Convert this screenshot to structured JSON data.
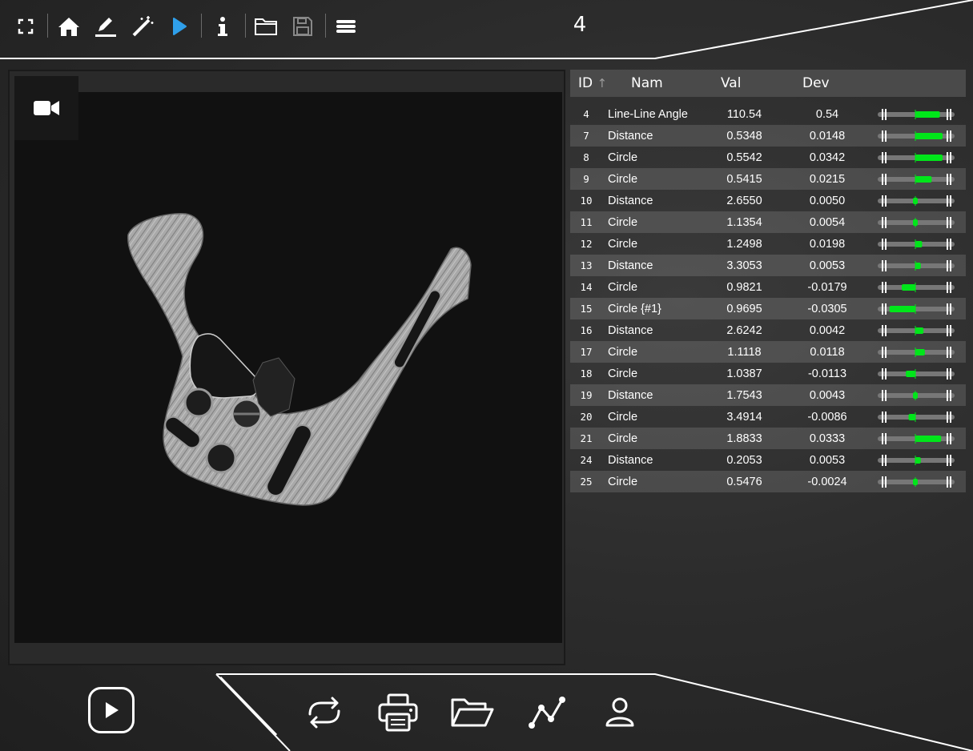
{
  "header": {
    "counter": "4"
  },
  "toolbar": {
    "icons": [
      "fullscreen-icon",
      "home-icon",
      "edit-icon",
      "magic-wand-icon",
      "play-icon",
      "info-icon",
      "folder-icon",
      "save-icon",
      "menu-icon"
    ],
    "active_icon": "play-icon"
  },
  "viewer": {
    "camera_icon": "video-camera-icon"
  },
  "table": {
    "headers": {
      "id": "ID",
      "sort_arrow": "↑",
      "name": "Nam",
      "value": "Val",
      "deviation": "Dev"
    },
    "rows": [
      {
        "id": "4",
        "name": "Line-Line Angle",
        "value": "110.54",
        "dev": "0.54",
        "bar": 0.9
      },
      {
        "id": "7",
        "name": "Distance",
        "value": "0.5348",
        "dev": "0.0148",
        "bar": 1.0
      },
      {
        "id": "8",
        "name": "Circle",
        "value": "0.5542",
        "dev": "0.0342",
        "bar": 1.0
      },
      {
        "id": "9",
        "name": "Circle",
        "value": "0.5415",
        "dev": "0.0215",
        "bar": 0.6
      },
      {
        "id": "10",
        "name": "Distance",
        "value": "2.6550",
        "dev": "0.0050",
        "bar": 0.08
      },
      {
        "id": "11",
        "name": "Circle",
        "value": "1.1354",
        "dev": "0.0054",
        "bar": 0.08
      },
      {
        "id": "12",
        "name": "Circle",
        "value": "1.2498",
        "dev": "0.0198",
        "bar": 0.25
      },
      {
        "id": "13",
        "name": "Distance",
        "value": "3.3053",
        "dev": "0.0053",
        "bar": 0.2
      },
      {
        "id": "14",
        "name": "Circle",
        "value": "0.9821",
        "dev": "-0.0179",
        "bar": -0.5
      },
      {
        "id": "15",
        "name": "Circle {#1}",
        "value": "0.9695",
        "dev": "-0.0305",
        "bar": -0.95
      },
      {
        "id": "16",
        "name": "Distance",
        "value": "2.6242",
        "dev": "0.0042",
        "bar": 0.3
      },
      {
        "id": "17",
        "name": "Circle",
        "value": "1.1118",
        "dev": "0.0118",
        "bar": 0.35
      },
      {
        "id": "18",
        "name": "Circle",
        "value": "1.0387",
        "dev": "-0.0113",
        "bar": -0.35
      },
      {
        "id": "19",
        "name": "Distance",
        "value": "1.7543",
        "dev": "0.0043",
        "bar": 0.08
      },
      {
        "id": "20",
        "name": "Circle",
        "value": "3.4914",
        "dev": "-0.0086",
        "bar": -0.25
      },
      {
        "id": "21",
        "name": "Circle",
        "value": "1.8833",
        "dev": "0.0333",
        "bar": 0.95
      },
      {
        "id": "24",
        "name": "Distance",
        "value": "0.2053",
        "dev": "0.0053",
        "bar": 0.2
      },
      {
        "id": "25",
        "name": "Circle",
        "value": "0.5476",
        "dev": "-0.0024",
        "bar": 0.05
      }
    ]
  },
  "bottom": {
    "icons": [
      "play-circle-icon",
      "refresh-icon",
      "printer-icon",
      "folder-open-icon",
      "chart-line-icon",
      "user-icon"
    ]
  },
  "colors": {
    "accent_blue": "#2f9fea",
    "bar_green": "#00e61a",
    "bar_track": "#777777"
  }
}
